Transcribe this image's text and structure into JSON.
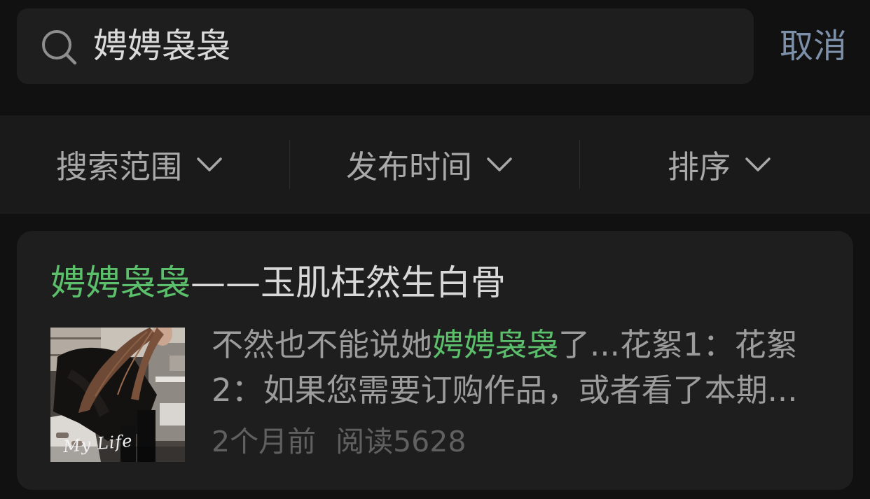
{
  "search": {
    "icon": "search-icon",
    "query": "娉娉袅袅",
    "cancel_label": "取消"
  },
  "filters": [
    {
      "label": "搜索范围",
      "icon": "chevron-down-icon"
    },
    {
      "label": "发布时间",
      "icon": "chevron-down-icon"
    },
    {
      "label": "排序",
      "icon": "chevron-down-icon"
    }
  ],
  "results": [
    {
      "title_highlight": "娉娉袅袅",
      "title_rest": "——玉肌枉然生白骨",
      "thumbnail_caption": "My Life",
      "excerpt": {
        "line1_before": "不然也不能说她",
        "line1_highlight": "娉娉袅袅",
        "line1_after": "了...花絮1：花絮",
        "line2": "2：如果您需要订购作品，或者看了本期..."
      },
      "meta": {
        "time": "2个月前",
        "reads": "阅读5628"
      }
    }
  ],
  "colors": {
    "background": "#111111",
    "highlight": "#5bbf6b",
    "link": "#7d90a9",
    "card": "#1e1e1e"
  }
}
